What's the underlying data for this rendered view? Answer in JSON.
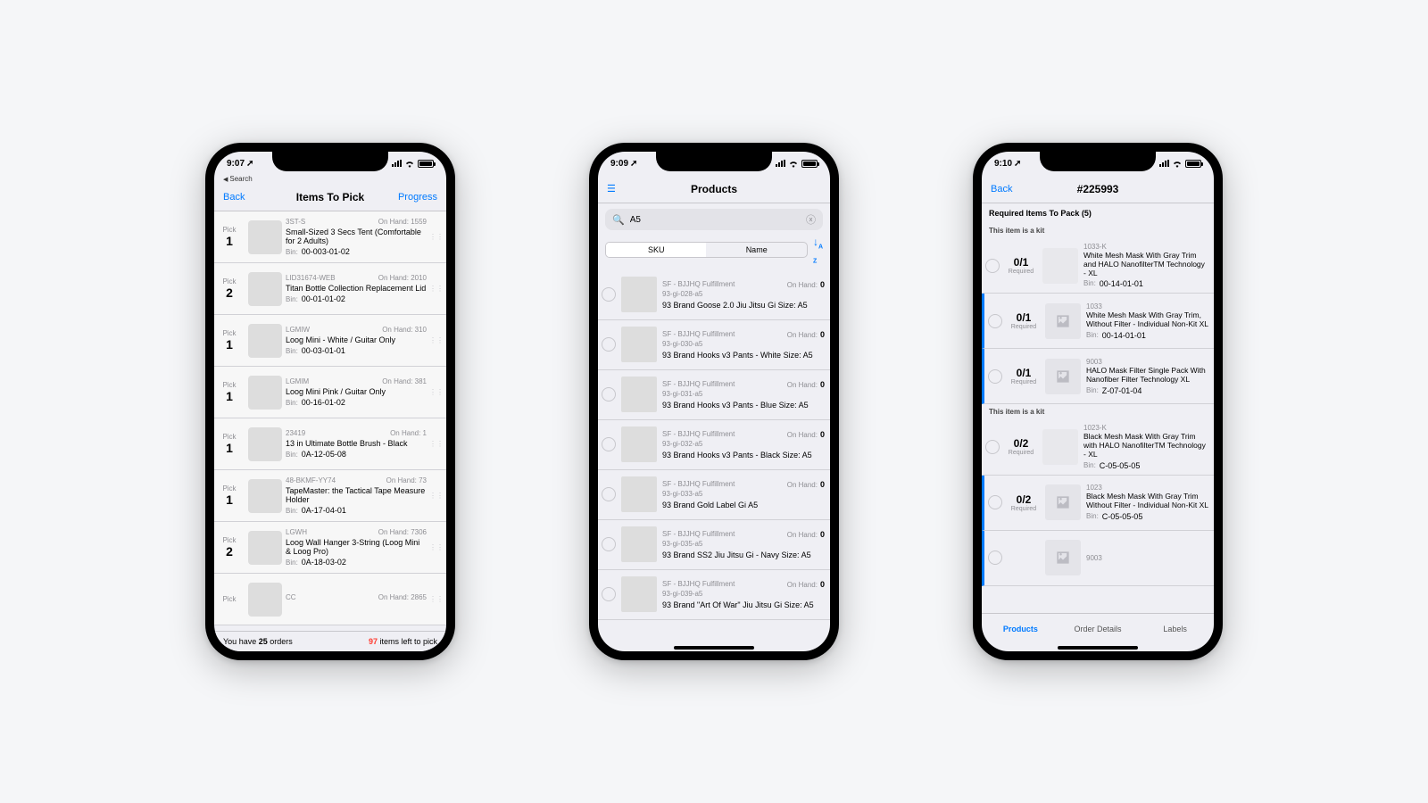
{
  "phone1": {
    "status": {
      "time": "9:07",
      "back_label": "Search"
    },
    "nav": {
      "left": "Back",
      "title": "Items To Pick",
      "right": "Progress"
    },
    "items": [
      {
        "pick_label": "Pick",
        "pick": "1",
        "sku": "3ST-S",
        "onhand_label": "On Hand:",
        "onhand": "1559",
        "name": "Small-Sized 3 Secs Tent (Comfortable for 2 Adults)",
        "bin_label": "Bin:",
        "bin": "00-003-01-02"
      },
      {
        "pick_label": "Pick",
        "pick": "2",
        "sku": "LID31674-WEB",
        "onhand_label": "On Hand:",
        "onhand": "2010",
        "name": "Titan Bottle Collection Replacement Lid",
        "bin_label": "Bin:",
        "bin": "00-01-01-02"
      },
      {
        "pick_label": "Pick",
        "pick": "1",
        "sku": "LGMIW",
        "onhand_label": "On Hand:",
        "onhand": "310",
        "name": "Loog Mini - White / Guitar Only",
        "bin_label": "Bin:",
        "bin": "00-03-01-01"
      },
      {
        "pick_label": "Pick",
        "pick": "1",
        "sku": "LGMIM",
        "onhand_label": "On Hand:",
        "onhand": "381",
        "name": "Loog Mini Pink / Guitar Only",
        "bin_label": "Bin:",
        "bin": "00-16-01-02"
      },
      {
        "pick_label": "Pick",
        "pick": "1",
        "sku": "23419",
        "onhand_label": "On Hand:",
        "onhand": "1",
        "name": "13 in Ultimate Bottle Brush - Black",
        "bin_label": "Bin:",
        "bin": "0A-12-05-08"
      },
      {
        "pick_label": "Pick",
        "pick": "1",
        "sku": "48-BKMF-YY74",
        "onhand_label": "On Hand:",
        "onhand": "73",
        "name": "TapeMaster: the Tactical Tape Measure Holder",
        "bin_label": "Bin:",
        "bin": "0A-17-04-01"
      },
      {
        "pick_label": "Pick",
        "pick": "2",
        "sku": "LGWH",
        "onhand_label": "On Hand:",
        "onhand": "7306",
        "name": "Loog Wall Hanger 3-String (Loog Mini & Loog Pro)",
        "bin_label": "Bin:",
        "bin": "0A-18-03-02"
      },
      {
        "pick_label": "Pick",
        "pick": "",
        "sku": "CC",
        "onhand_label": "On Hand:",
        "onhand": "2865",
        "name": "",
        "bin_label": "",
        "bin": ""
      }
    ],
    "footer": {
      "left_a": "You have ",
      "left_b": "25",
      "left_c": " orders",
      "right_a": "97",
      "right_b": " items left to pick"
    }
  },
  "phone2": {
    "status": {
      "time": "9:09"
    },
    "nav": {
      "title": "Products"
    },
    "search": {
      "value": "A5"
    },
    "segments": {
      "a": "SKU",
      "b": "Name"
    },
    "onhand_label": "On Hand:",
    "products": [
      {
        "fulfill": "SF - BJJHQ Fulfillment",
        "sku": "93-gi-028-a5",
        "onhand": "0",
        "name": "93 Brand Goose 2.0 Jiu Jitsu Gi  Size: A5"
      },
      {
        "fulfill": "SF - BJJHQ Fulfillment",
        "sku": "93-gi-030-a5",
        "onhand": "0",
        "name": "93 Brand Hooks v3 Pants - White Size: A5"
      },
      {
        "fulfill": "SF - BJJHQ Fulfillment",
        "sku": "93-gi-031-a5",
        "onhand": "0",
        "name": "93 Brand Hooks v3 Pants - Blue Size: A5"
      },
      {
        "fulfill": "SF - BJJHQ Fulfillment",
        "sku": "93-gi-032-a5",
        "onhand": "0",
        "name": "93 Brand Hooks v3 Pants - Black Size: A5"
      },
      {
        "fulfill": "SF - BJJHQ Fulfillment",
        "sku": "93-gi-033-a5",
        "onhand": "0",
        "name": "93 Brand Gold Label Gi A5"
      },
      {
        "fulfill": "SF - BJJHQ Fulfillment",
        "sku": "93-gi-035-a5",
        "onhand": "0",
        "name": "93 Brand SS2 Jiu Jitsu Gi - Navy Size: A5"
      },
      {
        "fulfill": "SF - BJJHQ Fulfillment",
        "sku": "93-gi-039-a5",
        "onhand": "0",
        "name": "93 Brand \"Art Of War\" Jiu Jitsu Gi Size: A5"
      }
    ]
  },
  "phone3": {
    "status": {
      "time": "9:10"
    },
    "nav": {
      "left": "Back",
      "title": "#225993"
    },
    "header": "Required Items To Pack (5)",
    "kit_label": "This item is a kit",
    "required_label": "Required",
    "bin_label": "Bin:",
    "rows": [
      {
        "kit": false,
        "frac": "0/1",
        "sku": "1033-K",
        "name": "White Mesh Mask With Gray Trim and HALO NanofilterTM Technology - XL",
        "bin": "00-14-01-01"
      },
      {
        "kit": true,
        "frac": "0/1",
        "sku": "1033",
        "name": "White Mesh Mask With Gray Trim, Without Filter - Individual Non-Kit XL",
        "bin": "00-14-01-01"
      },
      {
        "kit": true,
        "frac": "0/1",
        "sku": "9003",
        "name": "HALO Mask Filter Single Pack With Nanofiber Filter Technology XL",
        "bin": "Z-07-01-04"
      },
      {
        "kit": false,
        "frac": "0/2",
        "sku": "1023-K",
        "name": "Black Mesh Mask With Gray Trim with HALO NanofilterTM Technology - XL",
        "bin": "C-05-05-05"
      },
      {
        "kit": true,
        "frac": "0/2",
        "sku": "1023",
        "name": "Black Mesh Mask With Gray Trim Without Filter - Individual Non-Kit XL",
        "bin": "C-05-05-05"
      },
      {
        "kit": true,
        "frac": "",
        "sku": "9003",
        "name": "",
        "bin": ""
      }
    ],
    "tabs": {
      "a": "Products",
      "b": "Order Details",
      "c": "Labels"
    }
  }
}
